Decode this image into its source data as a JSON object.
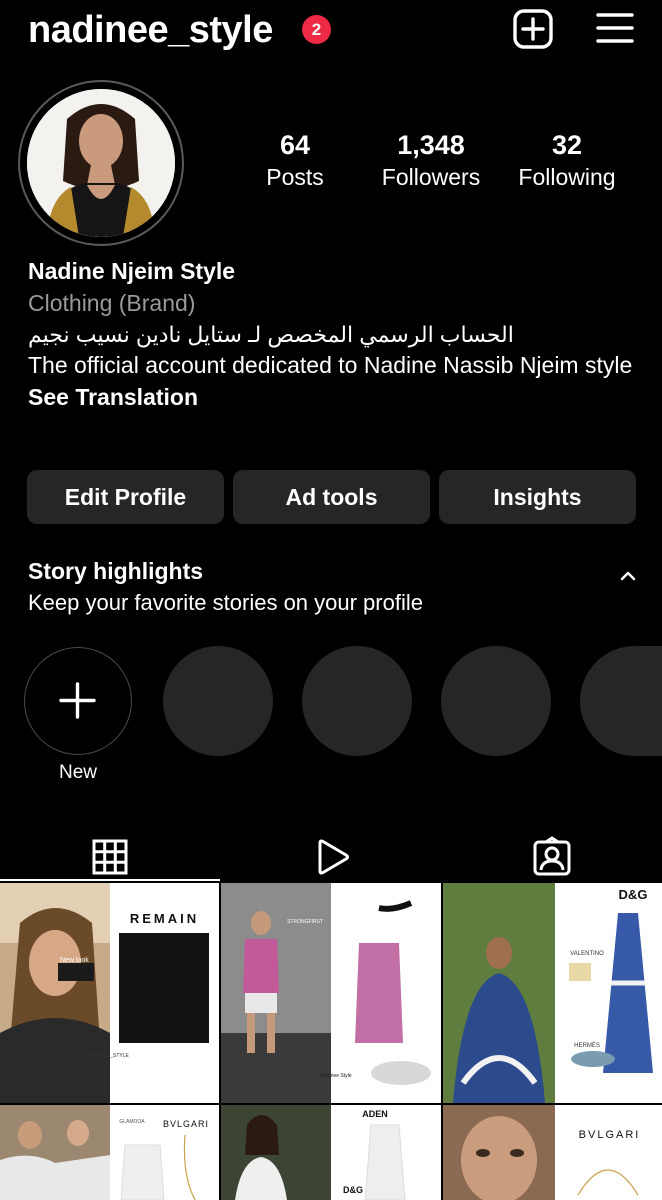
{
  "header": {
    "username": "nadinee_style",
    "notification_count": "2",
    "icons": [
      "plus-square-icon",
      "hamburger-menu-icon"
    ]
  },
  "stats": [
    {
      "value": "64",
      "label": "Posts"
    },
    {
      "value": "1,348",
      "label": "Followers"
    },
    {
      "value": "32",
      "label": "Following"
    }
  ],
  "bio": {
    "name": "Nadine Njeim Style",
    "category": "Clothing (Brand)",
    "arabic_line": "الحساب الرسمي المخصص لـ ستايل نادين نسيب نجيم",
    "english_line": "The official account dedicated to Nadine Nassib Njeim style",
    "see_translation": "See Translation"
  },
  "buttons": {
    "edit_profile": "Edit Profile",
    "ad_tools": "Ad tools",
    "insights": "Insights"
  },
  "highlights": {
    "title": "Story highlights",
    "subtitle": "Keep your favorite stories on your profile",
    "new_label": "New"
  },
  "tabs": {
    "icons": [
      "grid-icon",
      "reels-play-icon",
      "tagged-person-icon"
    ],
    "active": "grid-icon"
  },
  "posts": [
    {
      "brand_text": "REMAIN",
      "caption": "New look",
      "overlay": "NADINEE_STYLE"
    },
    {
      "brand_text": "STRONGFIRST",
      "overlay": "Nadinee Style"
    },
    {
      "brand_text": "D&G",
      "sub_brands": [
        "VALENTINO",
        "HERMÈS"
      ]
    },
    {
      "brand_text": "BVLGARI",
      "sub_brands": [
        "GLAMOOA"
      ]
    },
    {
      "brand_text": "ADEN",
      "sub_brands": [
        "D&G"
      ]
    },
    {
      "brand_text": "BVLGARI"
    }
  ],
  "colors": {
    "background": "#000000",
    "button_bg": "#262626",
    "badge": "#ee2a45",
    "muted_text": "#9a9a9a"
  }
}
